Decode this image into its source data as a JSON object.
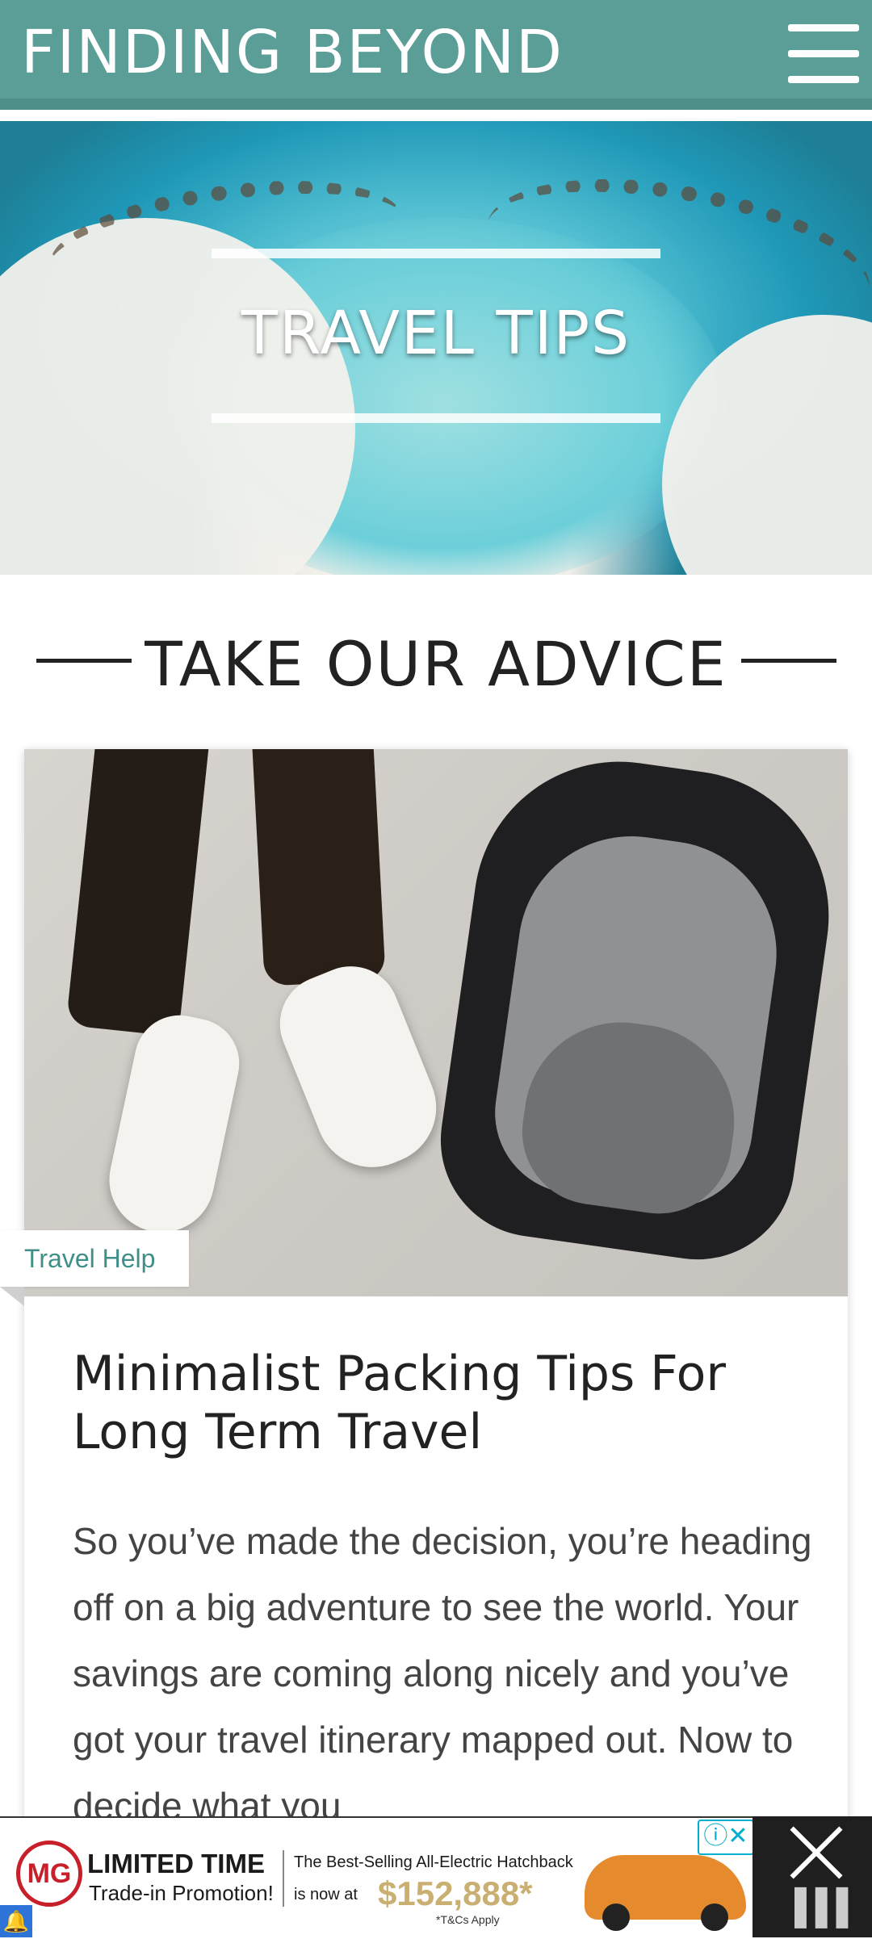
{
  "header": {
    "brand": "FINDING BEYOND",
    "menu_icon": "hamburger-menu-icon",
    "background": "#5b9e98"
  },
  "hero": {
    "title": "TRAVEL TIPS"
  },
  "section": {
    "title": "TAKE OUR ADVICE"
  },
  "post": {
    "category": "Travel Help",
    "title": "Minimalist Packing Tips For Long Term Travel",
    "excerpt": "So you’ve made the decision, you’re heading off on a big adventure to see the world. Your savings are coming along nicely and you’ve got your travel itinerary mapped out. Now to decide what you",
    "accent_color": "#3f8f88"
  },
  "ad": {
    "logo": "MG",
    "headline": "LIMITED TIME",
    "subline": "Trade-in Promotion!",
    "tagline": "The Best-Selling All-Electric Hatchback",
    "now_at": "is now at",
    "price": "$152,888*",
    "terms": "*T&Cs Apply",
    "choices_icon": "adchoices-icon",
    "close_icon": "close-icon"
  }
}
